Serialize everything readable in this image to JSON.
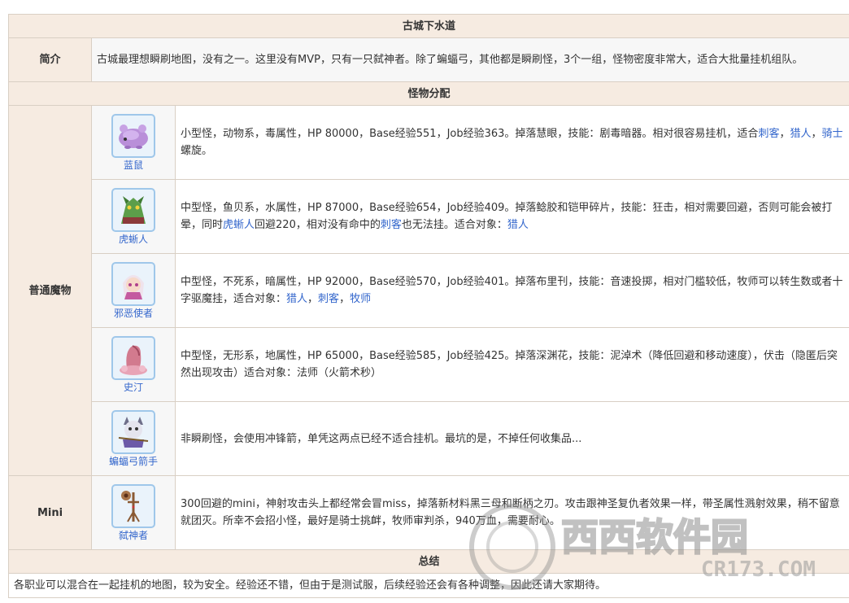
{
  "title": "古城下水道",
  "intro": {
    "label": "简介",
    "text": "古城最理想瞬刷地图，没有之一。这里没有MVP，只有一只弑神者。除了蝙蝠弓，其他都是瞬刷怪，3个一组，怪物密度非常大，适合大批量挂机组队。"
  },
  "section_monsters": "怪物分配",
  "normal_label": "普通魔物",
  "monsters": [
    {
      "name": "蓝鼠",
      "icon": "blue-rat-icon",
      "d1": "小型怪，动物系，毒属性，HP 80000，Base经验551，Job经验363。掉落慧眼，技能：剧毒暗器。相对很容易挂机，适合",
      "l1": "刺客",
      "d2": "，",
      "l2": "猎人",
      "d3": "，",
      "l3": "骑士",
      "d4": "螺旋。"
    },
    {
      "name": "虎蜥人",
      "icon": "tiger-lizard-icon",
      "d1": "中型怪，鱼贝系，水属性，HP 87000，Base经验654，Job经验409。掉落鲶胶和铠甲碎片，技能：狂击，相对需要回避，否则可能会被打晕，同时",
      "l1": "虎蜥人",
      "d2": "回避220，相对没有命中的",
      "l2": "刺客",
      "d3": "也无法挂。适合对象：",
      "l3": "猎人",
      "d4": ""
    },
    {
      "name": "邪恶使者",
      "icon": "evil-envoy-icon",
      "d1": "中型怪，不死系，暗属性，HP 92000，Base经验570，Job经验401。掉落布里刊，技能：音速投掷，相对门槛较低，牧师可以转生数或者十字驱魔挂，适合对象：",
      "l1": "猎人",
      "d2": "，",
      "l2": "刺客",
      "d3": "，",
      "l3": "牧师",
      "d4": ""
    },
    {
      "name": "史汀",
      "icon": "stinger-slime-icon",
      "d1": "中型怪，无形系，地属性，HP 65000，Base经验585，Job经验425。掉落深渊花，技能：泥淖术（降低回避和移动速度），伏击（隐匿后突然出现攻击）适合对象：法师（火箭术秒）",
      "l1": "",
      "d2": "",
      "l2": "",
      "d3": "",
      "l3": "",
      "d4": ""
    },
    {
      "name": "蝙蝠弓箭手",
      "icon": "bat-archer-icon",
      "d1": "非瞬刷怪，会使用冲锋箭，单凭这两点已经不适合挂机。最坑的是，不掉任何收集品...",
      "l1": "",
      "d2": "",
      "l2": "",
      "d3": "",
      "l3": "",
      "d4": ""
    }
  ],
  "mini": {
    "label": "Mini",
    "name": "弑神者",
    "icon": "godslayer-icon",
    "text": "300回避的mini，神射攻击头上都经常会冒miss，掉落新材料黑三母和断柄之刃。攻击跟神圣复仇者效果一样，带圣属性溅射效果，稍不留意就团灭。所幸不会招小怪，最好是骑士挑衅，牧师审判杀，940万血，需要耐心。"
  },
  "summary": {
    "label": "总结",
    "text": "各职业可以混合在一起挂机的地图，较为安全。经验还不错，但由于是测试服，后续经验还会有各种调整，因此还请大家期待。"
  },
  "watermark": {
    "text": "西西软件园",
    "sub": "CR173.COM"
  }
}
